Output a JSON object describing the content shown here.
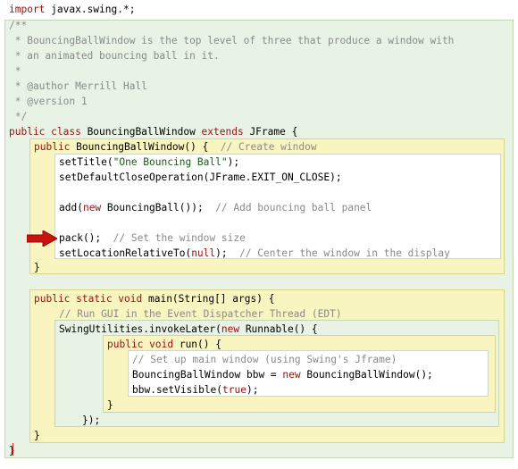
{
  "code": {
    "import_kw": "import",
    "import_rest": " javax.swing.*;",
    "doc_lines": [
      "/**",
      " * BouncingBallWindow is the top level of three that produce a window with",
      " * an animated bouncing ball in it.",
      " *",
      " * @author Merrill Hall",
      " * @version 1",
      " */"
    ],
    "class_kw1": "public class",
    "class_name": " BouncingBallWindow ",
    "class_kw2": "extends",
    "class_rest": " JFrame {",
    "ctor_kw": "public",
    "ctor_sig": " BouncingBallWindow() {  ",
    "ctor_comment": "// Create window",
    "settitle_a": "setTitle(",
    "settitle_str": "\"One Bouncing Ball\"",
    "settitle_b": ");",
    "set_close": "setDefaultCloseOperation(JFrame.EXIT_ON_CLOSE);",
    "add_a": "add(",
    "add_kw": "new",
    "add_b": " BouncingBall());  ",
    "add_comment": "// Add bouncing ball panel",
    "pack_code": "pack();  ",
    "pack_comment": "// Set the window size",
    "setloc_a": "setLocationRelativeTo(",
    "setloc_null": "null",
    "setloc_b": ");  ",
    "setloc_comment": "// Center the window in the display",
    "ctor_close": "}",
    "main_kw": "public static void",
    "main_sig": " main(String[] args) {",
    "main_comment": "// Run GUI in the Event Dispatcher Thread (EDT)",
    "invoke_a": "SwingUtilities.invokeLater(",
    "invoke_kw": "new",
    "invoke_b": " Runnable() {",
    "run_kw": "public void",
    "run_sig": " run() {",
    "run_comment": "// Set up main window (using Swing's Jframe)",
    "bbw_a": "BouncingBallWindow bbw = ",
    "bbw_kw": "new",
    "bbw_b": " BouncingBallWindow();",
    "visible_a": "bbw.setVisible(",
    "visible_kw": "true",
    "visible_b": ");",
    "run_close": "}",
    "invoke_close": "});",
    "main_close": "}",
    "class_close": "}"
  },
  "colors": {
    "keyword": "#9a1010",
    "comment": "#8a8a8a",
    "string": "#1a5a1a",
    "block_green": "#e8f3e6",
    "block_yellow": "#f8f5c0",
    "arrow": "#cc1111"
  },
  "icons": {
    "arrow": "arrow-right-icon"
  }
}
